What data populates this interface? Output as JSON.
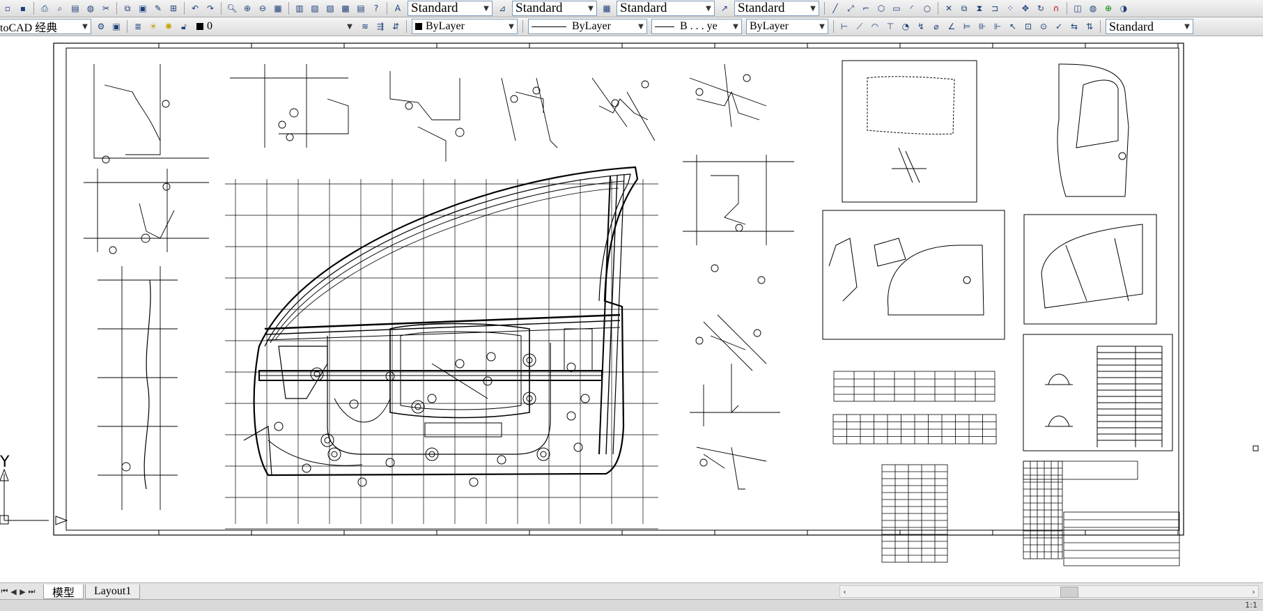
{
  "toolbar1": {
    "icons": [
      "new-icon",
      "open-icon",
      "save-icon",
      "print-icon",
      "preview-icon",
      "publish-icon",
      "3d-dwf-icon",
      "cut-icon",
      "copy-icon",
      "paste-icon",
      "match-properties-icon",
      "block-editor-icon",
      "undo-icon",
      "redo-icon",
      "pan-icon",
      "zoom-realtime-icon",
      "zoom-window-icon",
      "zoom-previous-icon",
      "properties-icon",
      "design-center-icon",
      "tool-palettes-icon",
      "sheet-set-icon",
      "markup-icon",
      "quickcalc-icon",
      "help-icon"
    ],
    "text_style": "Standard",
    "dim_style": "Standard",
    "table_style": "Standard",
    "mleader_style": "Standard",
    "draw_icons": [
      "line-icon",
      "xline-icon",
      "polyline-icon",
      "polygon-icon",
      "rectangle-icon",
      "arc-icon",
      "circle-icon",
      "revcloud-icon",
      "spline-icon",
      "ellipse-icon",
      "insert-icon",
      "block-icon",
      "point-icon",
      "hatch-icon",
      "region-icon",
      "mtext-icon"
    ]
  },
  "toolbar2": {
    "workspace": "AutoCAD 经典",
    "workspace_visible": "toCAD 经典",
    "layer": "0",
    "color": "ByLayer",
    "linetype": "ByLayer",
    "lineweight_visible": "B . . . ye",
    "plotstyle": "ByLayer",
    "dim_icons": [
      "linear-dim-icon",
      "aligned-dim-icon",
      "arc-length-icon",
      "ordinate-icon",
      "radius-icon",
      "jogged-icon",
      "diameter-icon",
      "angular-icon",
      "quick-dim-icon",
      "baseline-icon",
      "continue-icon",
      "qleader-icon",
      "tolerance-icon",
      "center-mark-icon",
      "dimedit-icon",
      "dimtedit-icon",
      "update-icon"
    ],
    "dim_style_right": "Standard"
  },
  "tabs": {
    "model": "模型",
    "layout": "Layout1"
  },
  "ucs": {
    "y_label": "Y"
  },
  "status": {
    "scale": "1:1"
  }
}
